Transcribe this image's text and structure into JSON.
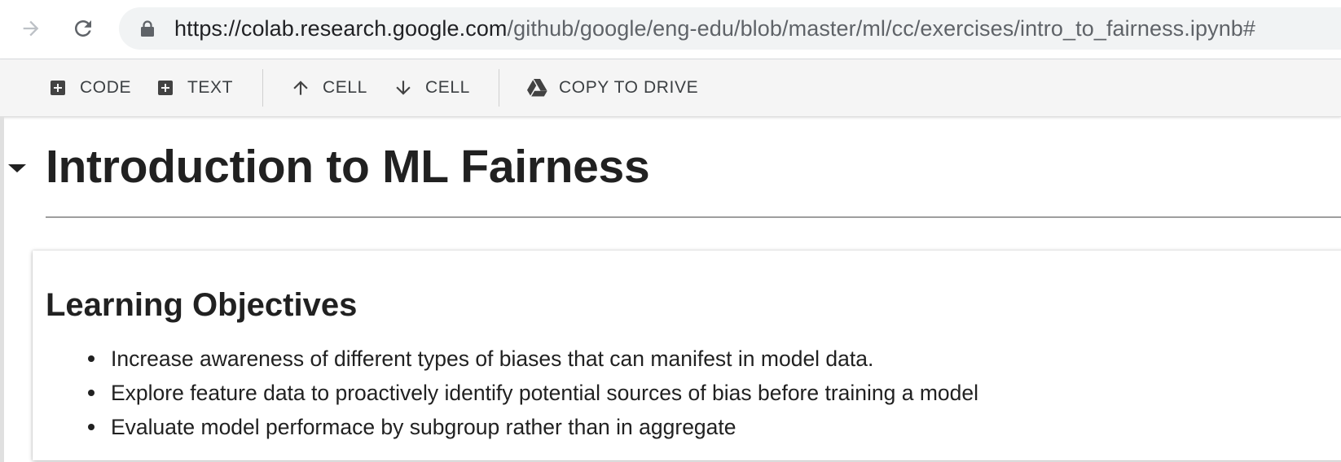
{
  "browser": {
    "url_host": "https://colab.research.google.com",
    "url_path": "/github/google/eng-edu/blob/master/ml/cc/exercises/intro_to_fairness.ipynb#"
  },
  "toolbar": {
    "code_label": "CODE",
    "text_label": "TEXT",
    "cell_up_label": "CELL",
    "cell_down_label": "CELL",
    "copy_to_drive_label": "COPY TO DRIVE"
  },
  "notebook": {
    "title": "Introduction to ML Fairness",
    "section": {
      "heading": "Learning Objectives",
      "items": [
        "Increase awareness of different types of biases that can manifest in model data.",
        "Explore feature data to proactively identify potential sources of bias before training a model",
        "Evaluate model performace by subgroup rather than in aggregate"
      ]
    }
  },
  "icons": {
    "forward": "arrow-forward-icon",
    "reload": "reload-icon",
    "lock": "lock-icon",
    "add_code": "add-box-icon",
    "add_text": "add-box-icon",
    "move_up": "arrow-up-icon",
    "move_down": "arrow-down-icon",
    "drive": "google-drive-icon",
    "collapse": "caret-down-icon"
  },
  "colors": {
    "toolbar_bg": "#f5f5f5",
    "omnibox_bg": "#f1f3f4",
    "text": "#212121",
    "icon": "#5f6368"
  }
}
